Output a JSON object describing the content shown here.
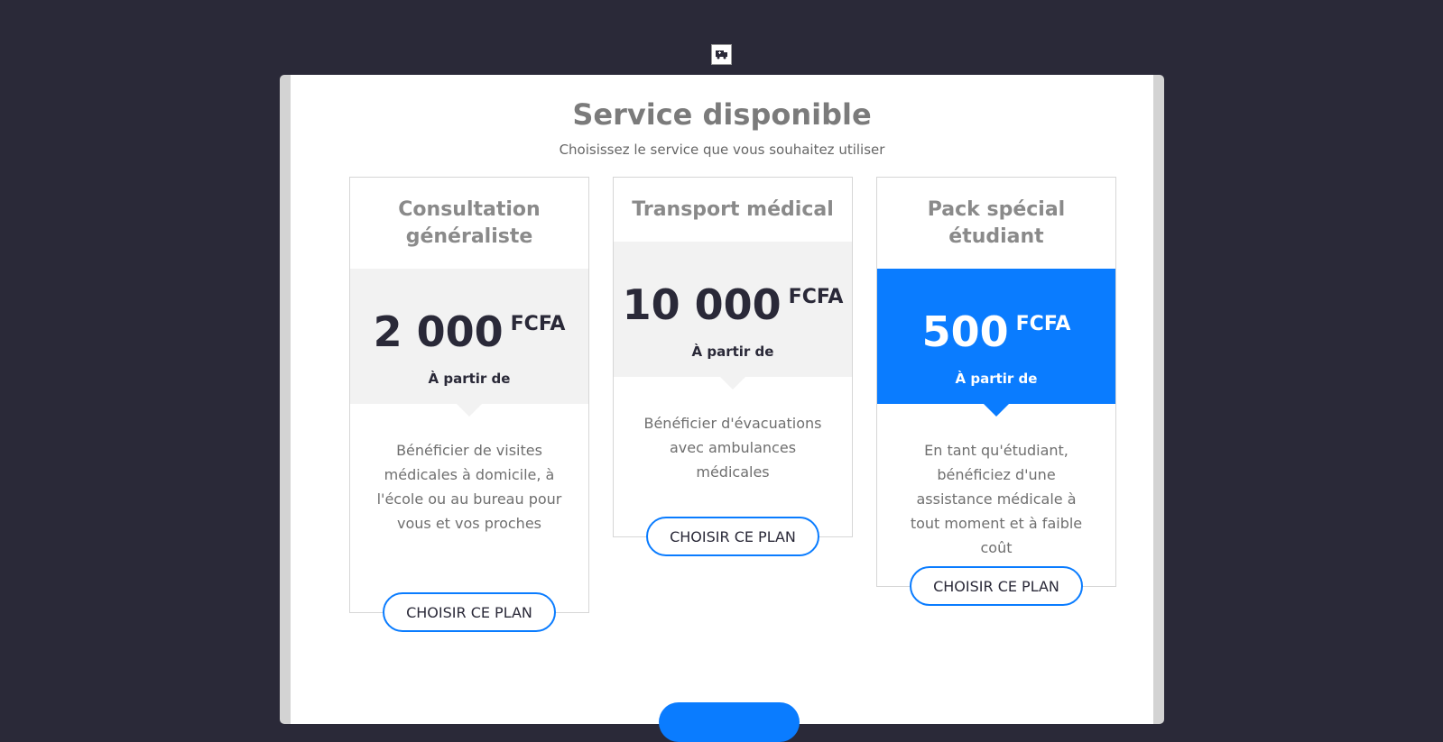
{
  "page": {
    "background": "#2a2938",
    "accent": "#0a7cff",
    "logo_icon": "ambulance-icon"
  },
  "header": {
    "title": "Service disponible",
    "subtitle": "Choisissez le service que vous souhaitez utiliser"
  },
  "plans": [
    {
      "name": "Consultation généraliste",
      "amount": "2 000",
      "currency": "FCFA",
      "from": "À partir de",
      "description": "Bénéficier de visites médicales à domicile, à l'école ou au bureau pour vous et vos proches",
      "button": "CHOISIR CE PLAN",
      "highlighted": false
    },
    {
      "name": "Transport médical",
      "amount": "10 000",
      "currency": "FCFA",
      "from": "À partir de",
      "description": "Bénéficier d'évacuations avec ambulances médicales",
      "button": "CHOISIR CE PLAN",
      "highlighted": false
    },
    {
      "name": "Pack spécial étudiant",
      "amount": "500",
      "currency": "FCFA",
      "from": "À partir de",
      "description": "En tant qu'étudiant, bénéficiez d'une assistance médicale à tout moment et à faible coût",
      "button": "CHOISIR CE PLAN",
      "highlighted": true
    }
  ]
}
